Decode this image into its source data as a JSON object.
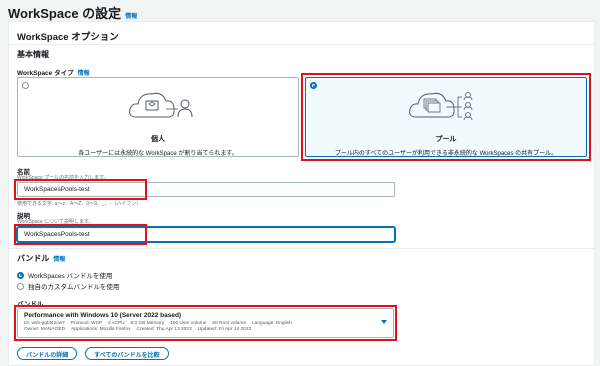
{
  "page": {
    "title": "WorkSpace の設定",
    "info": "情報"
  },
  "options": {
    "title": "WorkSpace オプション",
    "basic_info": "基本情報",
    "type_label": "WorkSpace タイプ",
    "type_info": "情報",
    "tiles": [
      {
        "label": "個人",
        "desc": "各ユーザーには永続的な WorkSpace が割り当てられます。",
        "selected": false,
        "icon": "personal-workspace-icon"
      },
      {
        "label": "プール",
        "desc": "プール内のすべてのユーザーが利用できる非永続的な WorkSpaces の共有プール。",
        "selected": true,
        "icon": "pool-workspace-icon"
      }
    ],
    "name_label": "名前",
    "name_desc": "WorkSpace プールの名前を入力します。",
    "name_value": "WorkSpacesPools-test",
    "name_hint": "使用できる文字: a〜z、A〜Z、0〜9、_、-（ハイフン）",
    "desc_label": "説明",
    "desc_desc": "WorkSpace について説明します。",
    "desc_value": "WorkSpacesPools-test"
  },
  "bundle": {
    "title": "バンドル",
    "info": "情報",
    "radio_options": [
      {
        "label": "WorkSpaces バンドルを使用",
        "selected": true
      },
      {
        "label": "独自のカスタムバンドルを使用",
        "selected": false
      }
    ],
    "select_label": "バンドル",
    "selected": {
      "name": "Performance with Windows 10 (Server 2022 based)",
      "line1": [
        "ID: wsb-gqbt42cw7",
        "Protocol: WSP",
        "2 vCPU",
        "8.0 GB Memory",
        "100 User volume",
        "80 Root volume",
        "Language: English"
      ],
      "line2": [
        "Owner: MANAGED",
        "Applications: Mozilla Firefox",
        "Created: Thu Apr 13 2023",
        "Updated: Fri Apr 14 2023"
      ]
    },
    "details_button": "バンドルの詳細",
    "compare_button": "すべてのバンドルを比較"
  },
  "colors": {
    "accent": "#0073bb",
    "highlight": "#e0101c"
  }
}
